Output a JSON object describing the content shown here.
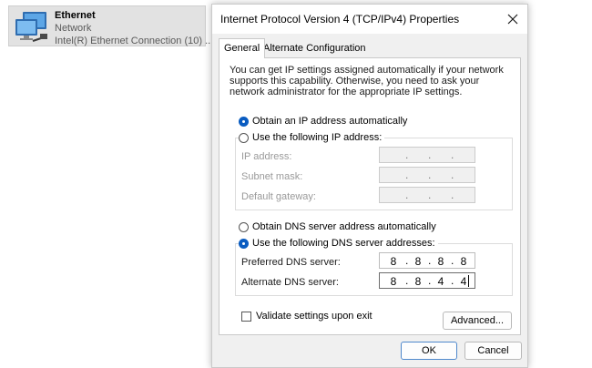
{
  "network_item": {
    "name": "Ethernet",
    "status": "Network",
    "adapter": "Intel(R) Ethernet Connection (10) ..."
  },
  "dialog": {
    "title": "Internet Protocol Version 4 (TCP/IPv4) Properties",
    "tabs": [
      "General",
      "Alternate Configuration"
    ],
    "description": "You can get IP settings assigned automatically if your network supports this capability. Otherwise, you need to ask your network administrator for the appropriate IP settings.",
    "ip_options": {
      "auto_label": "Obtain an IP address automatically",
      "manual_label": "Use the following IP address:",
      "selected": "auto"
    },
    "ip_fields": {
      "ip_address_label": "IP address:",
      "subnet_mask_label": "Subnet mask:",
      "default_gateway_label": "Default gateway:",
      "disabled": true
    },
    "dns_options": {
      "auto_label": "Obtain DNS server address automatically",
      "manual_label": "Use the following DNS server addresses:",
      "selected": "manual"
    },
    "dns_fields": {
      "preferred_label": "Preferred DNS server:",
      "preferred_value": [
        "8",
        "8",
        "8",
        "8"
      ],
      "alternate_label": "Alternate DNS server:",
      "alternate_value": [
        "8",
        "8",
        "4",
        "4"
      ]
    },
    "validate_label": "Validate settings upon exit",
    "validate_checked": false,
    "advanced_button": "Advanced...",
    "ok_button": "OK",
    "cancel_button": "Cancel"
  },
  "icons": {
    "network": "network-adapter-icon",
    "close": "close-icon"
  },
  "colors": {
    "accent": "#0a5cc1",
    "selected_item_bg": "#e2e2e2",
    "dialog_bg": "#f0f0f0"
  }
}
